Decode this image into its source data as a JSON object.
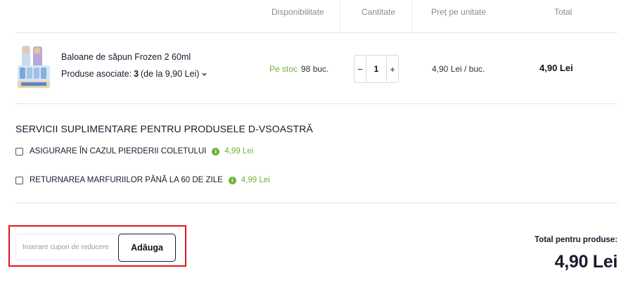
{
  "table_header": {
    "availability": "Disponibilitate",
    "quantity": "Cantitate",
    "unit_price": "Preț pe unitate",
    "total": "Total"
  },
  "product": {
    "name": "Baloane de săpun Frozen 2 60ml",
    "associated_label": "Produse asociate:",
    "associated_count": "3",
    "associated_price": "(de la 9,90 Lei)",
    "stock_status": "Pe stoc",
    "stock_qty": "98 buc.",
    "quantity": "1",
    "unit_price": "4,90 Lei / buc.",
    "total": "4,90 Lei",
    "thumbnail_icon": "product-thumbnail-icon"
  },
  "quantity_controls": {
    "minus": "−",
    "plus": "+"
  },
  "services": {
    "title": "SERVICII SUPLIMENTARE PENTRU PRODUSELE D-VSOASTRĂ",
    "items": [
      {
        "label": "ASIGURARE ÎN CAZUL PIERDERII COLETULUI",
        "price": "4,99 Lei",
        "info_icon": "i"
      },
      {
        "label": "RETURNAREA MARFURIILOR PÂNĂ LA 60 DE ZILE",
        "price": "4,99 Lei",
        "info_icon": "i"
      }
    ]
  },
  "coupon": {
    "placeholder": "Inserare cupon de reducere",
    "button": "Adăuga",
    "highlight_color": "#e0141e"
  },
  "summary": {
    "label": "Total pentru produse:",
    "value": "4,90 Lei"
  },
  "colors": {
    "accent_green": "#6db33f",
    "text": "#1a1a2e"
  }
}
